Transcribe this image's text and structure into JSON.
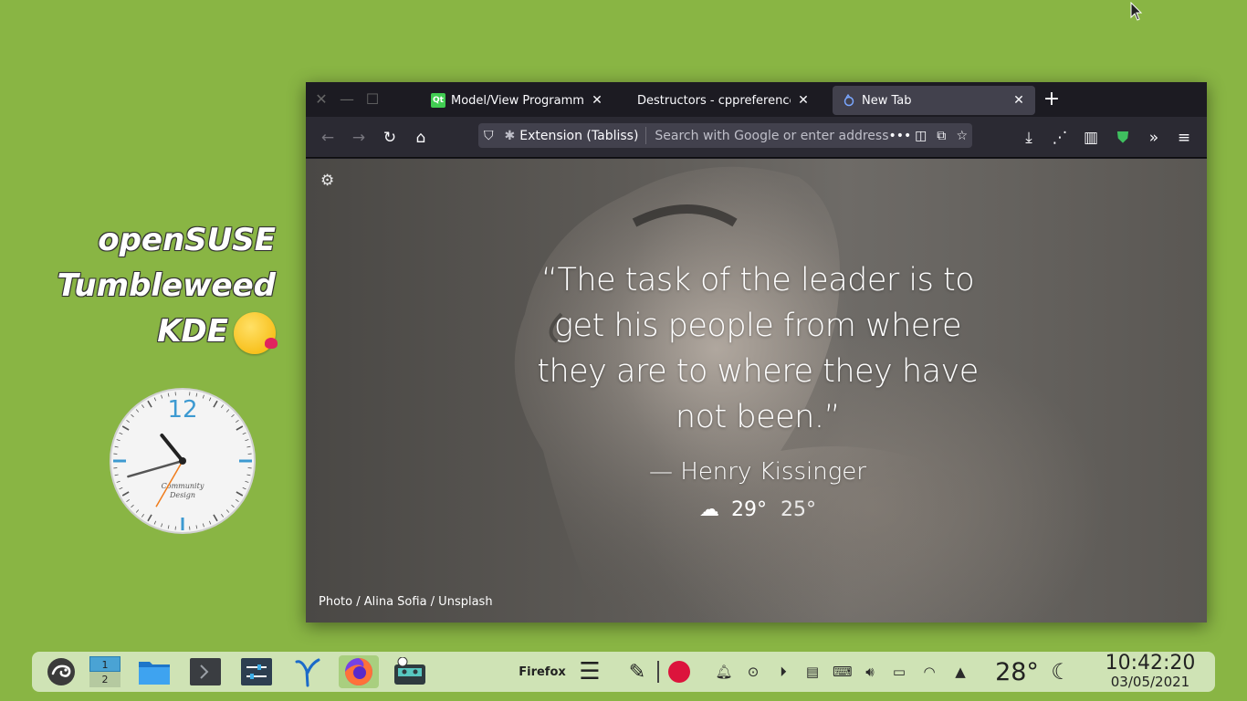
{
  "desktop": {
    "caption_lines": [
      "openSUSE",
      "Tumbleweed",
      "KDE"
    ],
    "clock": {
      "numeral": "12",
      "brand_line1": "Community",
      "brand_line2": "Design",
      "hour": 10,
      "minute": 42,
      "second": 20
    }
  },
  "browser": {
    "tabs": [
      {
        "label": "Model/View Programmin",
        "favicon": "Qt",
        "active": false
      },
      {
        "label": "Destructors - cppreference.c",
        "favicon": "",
        "active": false
      },
      {
        "label": "New Tab",
        "favicon": "tabliss-icon",
        "active": true
      }
    ],
    "urlbar": {
      "extension_label": "Extension (Tabliss)",
      "placeholder": "Search with Google or enter address"
    },
    "newtab": {
      "quote": "“The task of the leader is to get his people from where they are to where they have not been.”",
      "author": "— Henry Kissinger",
      "weather_high": "29°",
      "weather_low": "25°",
      "photo_credit": "Photo / Alina Sofia / Unsplash"
    }
  },
  "taskbar": {
    "pager": [
      "1",
      "2"
    ],
    "active_window_title": "Firefox",
    "temperature": "28°",
    "time": "10:42:20",
    "date": "03/05/2021"
  },
  "colors": {
    "desktop": "#89b544",
    "taskbar": "#cfe3b5",
    "record": "#dc143c",
    "clock_accent": "#3d9ad1",
    "clock_second_hand": "#f07c1b"
  }
}
